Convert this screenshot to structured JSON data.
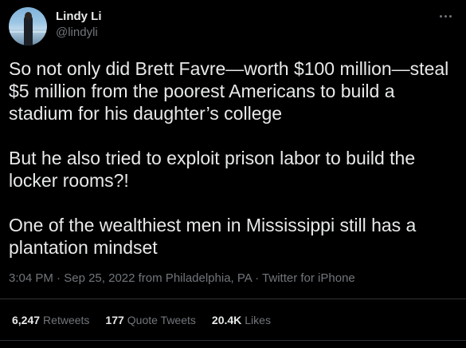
{
  "author": {
    "name": "Lindy Li",
    "handle": "@lindyli",
    "avatar_icon": "profile-photo"
  },
  "tweet": {
    "paragraphs": [
      "So not only did Brett Favre—worth $100 million—steal $5 million from the poorest Americans to build a stadium for his daughter’s college",
      "But he also tried to exploit prison labor to build the locker rooms?!",
      "One of the wealthiest men in Mississippi still has a plantation mindset"
    ],
    "time": "3:04 PM",
    "separator": "·",
    "date": "Sep 25, 2022",
    "location": "from Philadelphia, PA",
    "source": "Twitter for iPhone"
  },
  "stats": {
    "retweets": {
      "value": "6,247",
      "label": "Retweets"
    },
    "quote_tweets": {
      "value": "177",
      "label": "Quote Tweets"
    },
    "likes": {
      "value": "20.4K",
      "label": "Likes"
    }
  },
  "colors": {
    "background": "#000000",
    "text": "#e7e9ea",
    "secondary_text": "#71767b",
    "divider": "#2f3336"
  }
}
